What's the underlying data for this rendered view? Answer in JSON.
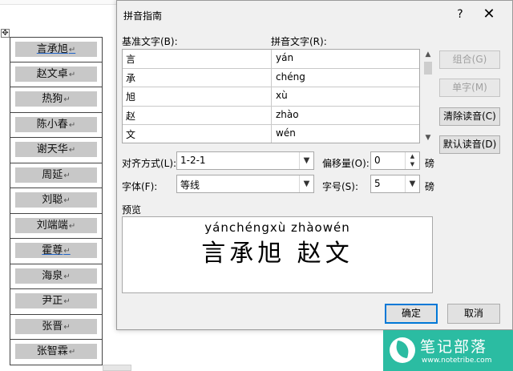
{
  "document": {
    "move_handle_glyph": "✥",
    "cell_mark": "↵",
    "names": [
      {
        "text": "言承旭",
        "underlined": true
      },
      {
        "text": "赵文卓",
        "underlined": false
      },
      {
        "text": "热狗",
        "underlined": false
      },
      {
        "text": "陈小春",
        "underlined": false
      },
      {
        "text": "谢天华",
        "underlined": false
      },
      {
        "text": "周延",
        "underlined": false
      },
      {
        "text": "刘聪",
        "underlined": false
      },
      {
        "text": "刘端端",
        "underlined": false
      },
      {
        "text": "霍尊",
        "underlined": true
      },
      {
        "text": "海泉",
        "underlined": false
      },
      {
        "text": "尹正",
        "underlined": false
      },
      {
        "text": "张晋",
        "underlined": false
      },
      {
        "text": "张智霖",
        "underlined": false
      }
    ]
  },
  "dialog": {
    "title": "拼音指南",
    "help_glyph": "?",
    "close_glyph": "✕",
    "base_text_label": "基准文字(B):",
    "ruby_text_label": "拼音文字(R):",
    "rows": [
      {
        "base": "言",
        "ruby": "yán"
      },
      {
        "base": "承",
        "ruby": "chéng"
      },
      {
        "base": "旭",
        "ruby": "xù"
      },
      {
        "base": "赵",
        "ruby": "zhào"
      },
      {
        "base": "文",
        "ruby": "wén"
      }
    ],
    "buttons": {
      "group": "组合(G)",
      "mono": "单字(M)",
      "clear": "清除读音(C)",
      "default": "默认读音(D)",
      "ok": "确定",
      "cancel": "取消"
    },
    "alignment_label": "对齐方式(L):",
    "alignment_value": "1-2-1",
    "offset_label": "偏移量(O):",
    "offset_value": "0",
    "offset_unit": "磅",
    "font_label": "字体(F):",
    "font_value": "等线",
    "size_label": "字号(S):",
    "size_value": "5",
    "size_unit": "磅",
    "preview_label": "预览",
    "preview_pinyin": "yánchéngxù zhàowén",
    "preview_chars": "言承旭 赵文"
  },
  "logo": {
    "title": "笔记部落",
    "url": "www.notetribe.com",
    "color": "#2bbca2"
  }
}
